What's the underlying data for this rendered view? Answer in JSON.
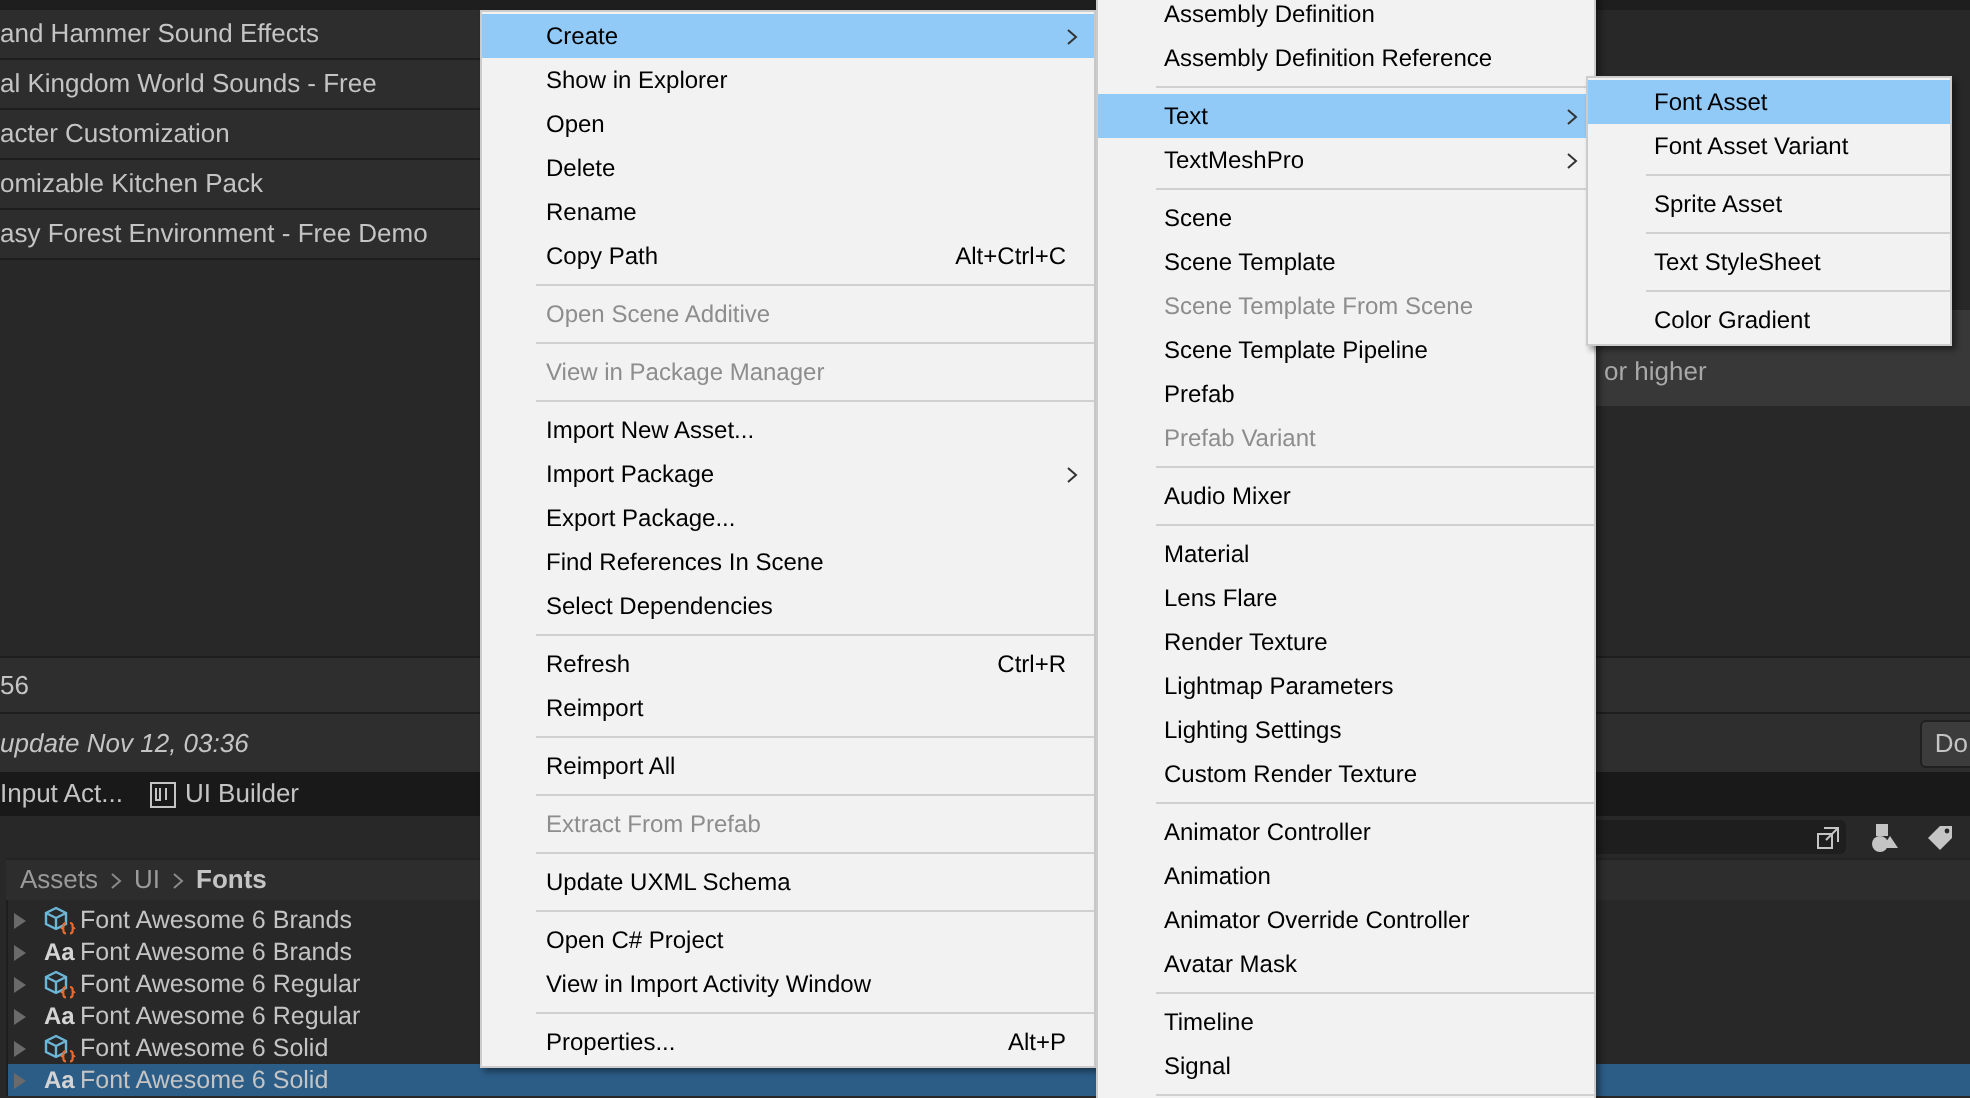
{
  "package_list": {
    "rows": [
      "and Hammer Sound Effects",
      "al Kingdom World Sounds - Free",
      "acter Customization",
      "omizable Kitchen Pack",
      "asy Forest Environment - Free Demo"
    ]
  },
  "details": {
    "note": "or higher"
  },
  "footer": {
    "count": "56",
    "update": "update Nov 12, 03:36",
    "button": "Do"
  },
  "tabs": [
    {
      "label": "Input Act...",
      "icon": false
    },
    {
      "label": "UI Builder",
      "icon": true
    }
  ],
  "breadcrumb": [
    "Assets",
    "UI",
    "Fonts"
  ],
  "assets": [
    {
      "kind": "font_asset",
      "label": "Font Awesome 6 Brands",
      "selected": false
    },
    {
      "kind": "font",
      "badge": "Aa",
      "label": "Font Awesome 6 Brands",
      "selected": false
    },
    {
      "kind": "font_asset",
      "label": "Font Awesome 6 Regular",
      "selected": false
    },
    {
      "kind": "font",
      "badge": "Aa",
      "label": "Font Awesome 6 Regular",
      "selected": false
    },
    {
      "kind": "font_asset",
      "label": "Font Awesome 6 Solid",
      "selected": false
    },
    {
      "kind": "font",
      "badge": "Aa",
      "label": "Font Awesome 6 Solid",
      "selected": true
    }
  ],
  "context_menu": [
    {
      "kind": "item",
      "label": "Create",
      "submenu": true,
      "selected": true
    },
    {
      "kind": "item",
      "label": "Show in Explorer"
    },
    {
      "kind": "item",
      "label": "Open"
    },
    {
      "kind": "item",
      "label": "Delete"
    },
    {
      "kind": "item",
      "label": "Rename"
    },
    {
      "kind": "item",
      "label": "Copy Path",
      "shortcut": "Alt+Ctrl+C"
    },
    {
      "kind": "separator"
    },
    {
      "kind": "item",
      "label": "Open Scene Additive",
      "disabled": true
    },
    {
      "kind": "separator"
    },
    {
      "kind": "item",
      "label": "View in Package Manager",
      "disabled": true
    },
    {
      "kind": "separator"
    },
    {
      "kind": "item",
      "label": "Import New Asset..."
    },
    {
      "kind": "item",
      "label": "Import Package",
      "submenu": true
    },
    {
      "kind": "item",
      "label": "Export Package..."
    },
    {
      "kind": "item",
      "label": "Find References In Scene"
    },
    {
      "kind": "item",
      "label": "Select Dependencies"
    },
    {
      "kind": "separator"
    },
    {
      "kind": "item",
      "label": "Refresh",
      "shortcut": "Ctrl+R"
    },
    {
      "kind": "item",
      "label": "Reimport"
    },
    {
      "kind": "separator"
    },
    {
      "kind": "item",
      "label": "Reimport All"
    },
    {
      "kind": "separator"
    },
    {
      "kind": "item",
      "label": "Extract From Prefab",
      "disabled": true
    },
    {
      "kind": "separator"
    },
    {
      "kind": "item",
      "label": "Update UXML Schema"
    },
    {
      "kind": "separator"
    },
    {
      "kind": "item",
      "label": "Open C# Project"
    },
    {
      "kind": "item",
      "label": "View in Import Activity Window"
    },
    {
      "kind": "separator"
    },
    {
      "kind": "item",
      "label": "Properties...",
      "shortcut": "Alt+P"
    }
  ],
  "create_menu": [
    {
      "kind": "item",
      "label": "Assembly Definition"
    },
    {
      "kind": "item",
      "label": "Assembly Definition Reference"
    },
    {
      "kind": "separator"
    },
    {
      "kind": "item",
      "label": "Text",
      "submenu": true,
      "selected": true
    },
    {
      "kind": "item",
      "label": "TextMeshPro",
      "submenu": true
    },
    {
      "kind": "separator"
    },
    {
      "kind": "item",
      "label": "Scene"
    },
    {
      "kind": "item",
      "label": "Scene Template"
    },
    {
      "kind": "item",
      "label": "Scene Template From Scene",
      "disabled": true
    },
    {
      "kind": "item",
      "label": "Scene Template Pipeline"
    },
    {
      "kind": "item",
      "label": "Prefab"
    },
    {
      "kind": "item",
      "label": "Prefab Variant",
      "disabled": true
    },
    {
      "kind": "separator"
    },
    {
      "kind": "item",
      "label": "Audio Mixer"
    },
    {
      "kind": "separator"
    },
    {
      "kind": "item",
      "label": "Material"
    },
    {
      "kind": "item",
      "label": "Lens Flare"
    },
    {
      "kind": "item",
      "label": "Render Texture"
    },
    {
      "kind": "item",
      "label": "Lightmap Parameters"
    },
    {
      "kind": "item",
      "label": "Lighting Settings"
    },
    {
      "kind": "item",
      "label": "Custom Render Texture"
    },
    {
      "kind": "separator"
    },
    {
      "kind": "item",
      "label": "Animator Controller"
    },
    {
      "kind": "item",
      "label": "Animation"
    },
    {
      "kind": "item",
      "label": "Animator Override Controller"
    },
    {
      "kind": "item",
      "label": "Avatar Mask"
    },
    {
      "kind": "separator"
    },
    {
      "kind": "item",
      "label": "Timeline"
    },
    {
      "kind": "item",
      "label": "Signal"
    },
    {
      "kind": "separator"
    }
  ],
  "text_menu": [
    {
      "kind": "item",
      "label": "Font Asset",
      "selected": true
    },
    {
      "kind": "item",
      "label": "Font Asset Variant",
      "selected": false
    },
    {
      "kind": "separator"
    },
    {
      "kind": "item",
      "label": "Sprite Asset",
      "selected": false
    },
    {
      "kind": "separator"
    },
    {
      "kind": "item",
      "label": "Text StyleSheet",
      "selected": false
    },
    {
      "kind": "separator"
    },
    {
      "kind": "item",
      "label": "Color Gradient",
      "selected": false
    }
  ]
}
